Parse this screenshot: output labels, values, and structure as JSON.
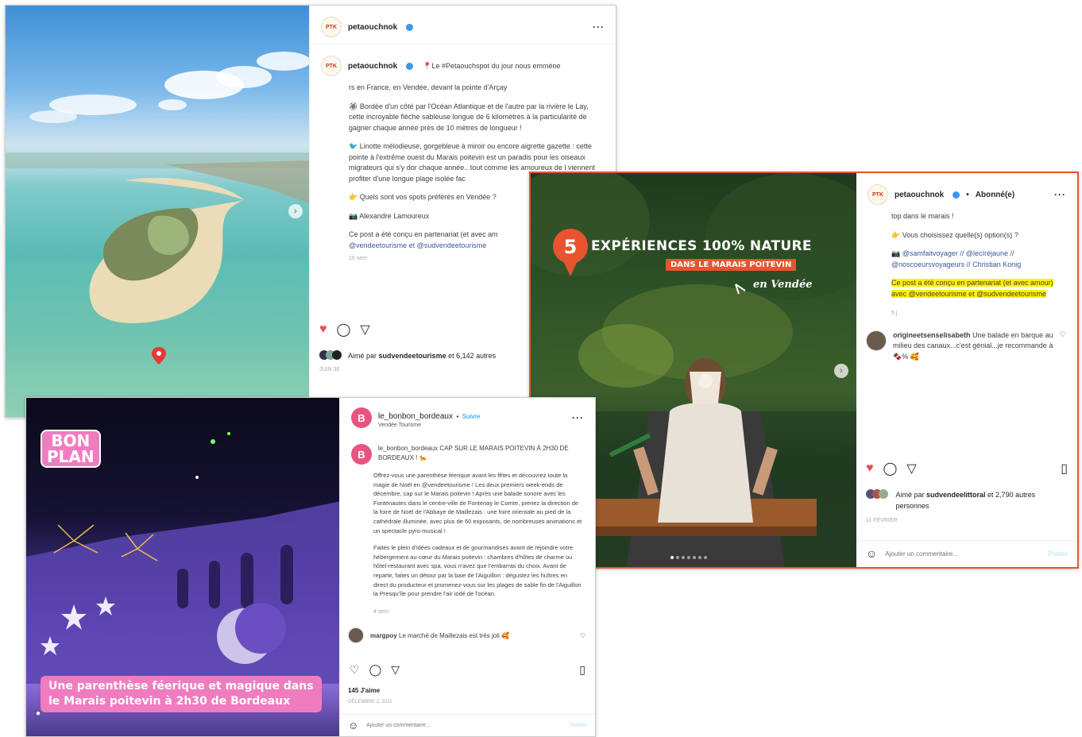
{
  "post1": {
    "username": "petaouchnok",
    "caption_intro": "📍Le #Petaouchspot du jour nous emmène",
    "caption_line2": "rs en France, en Vendée, devant la pointe d'Arçay",
    "para1": "🏵 Bordée d'un côté par l'Océan Atlantique et de l'autre par la rivière le Lay, cette incroyable flèche sableuse longue de 6 kilomètres à la particularité de gagner chaque année près de 10 mètres de longueur !",
    "para2": "🐦 Linotte mélodieuse, gorgebleue à miroir ou encore aigrette gazette : cette pointe à l'extrême ouest du Marais poitevin est un paradis pour les oiseaux migrateurs qui s'y dor chaque année.. tout comme les amoureux de l viennent profiter d'une longue plage isolée fac",
    "question": "👉 Quels sont vos spots préférés en Vendée ?",
    "photo_credit": "📷 Alexandre Lamoureux",
    "partnership": "Ce post a été conçu en partenariat (et avec am",
    "partners": "@vendeetourisme et @sudvendeetourisme",
    "time": "15 sem",
    "liked_by_prefix": "Aimé par",
    "liked_by_user": "sudvendeetourisme",
    "liked_by_rest": "et 6,142 autres",
    "date": "JUIN 30"
  },
  "post2": {
    "username": "petaouchnok",
    "follow_status": "Abonné(e)",
    "badge_number": "5",
    "headline": "EXPÉRIENCES 100% NATURE",
    "subheadline": "DANS LE MARAIS POITEVIN",
    "location_script": "en Vendée",
    "cap1": "top dans le marais !",
    "cap2": "👉 Vous choisissez quelle(s) option(s) ?",
    "cap3": "📷 @samfaitvoyager // @lecïréjaune // @noscoeursvoyageurs // Christian Konig",
    "cap4": "Ce post a été conçu en partenariat (et avec amour) avec @vendeetourisme et @sudvendeetourisme",
    "cap_time": "5 j",
    "comment_user": "origineetsenselisabeth",
    "comment_text": "Une balade en barque au milieu des canaux...c'est génial...je recommande à 🍫% 🥰",
    "liked_by_prefix": "Aimé par",
    "liked_by_user": "sudvendeelittoral",
    "liked_by_rest": "et 2,790 autres personnes",
    "date": "11 FÉVRIER",
    "comment_placeholder": "Ajouter un commentaire...",
    "publish": "Publier"
  },
  "post3": {
    "username": "le_bonbon_bordeaux",
    "follow": "Suivre",
    "subtitle": "Vendée Tourisme",
    "badge_line1": "BON",
    "badge_line2": "PLAN",
    "banner_line1": "Une parenthèse féerique et magique dans",
    "banner_line2": "le Marais poitevin à 2h30 de Bordeaux",
    "cap_title": "CAP SUR LE MARAIS POITEVIN À 2H30 DE BORDEAUX ! 🐆",
    "para1": "Offrez-vous une parenthèse féerique avant les fêtes et découvrez toute la magie de Noël en @vendeetourisme ! Les deux premiers week-ends de décembre, cap sur le Marais poitevin ! Après une balade sonore avec les Fontenautes dans le centre-ville de Fontenay le Comte, prenez la direction de la foire de Noël de l'Abbaye de Maillezais : une foire orientale au pied de la cathédrale illuminée, avec plus de 60 exposants, de nombreuses animations et un spectacle pyro-musical !",
    "para2": "Faites le plein d'idées cadeaux et de gourmandises avant de rejoindre votre hébergement au cœur du Marais poitevin : chambres d'hôtes de charme ou hôtel-restaurant avec spa, vous n'avez que l'embarras du choix. Avant de repartir, faites un détour par la baie de l'Aiguillon : dégustez les huîtres en direct du producteur et promenez-vous sur les plages de sable fin de l'Aiguillon la Presqu'île pour prendre l'air iodé de l'océan.",
    "time": "4 sem",
    "comment_user": "margpoy",
    "comment_text": "Le marché de Maillezais est très joli 🥰",
    "likes": "145 J'aime",
    "date": "DÉCEMBRE 2, 2022",
    "comment_placeholder": "Ajouter un commentaire...",
    "publish": "Publier"
  },
  "colors": {
    "accent_orange": "#e8542f",
    "pink": "#f07cc0",
    "ig_blue": "#3897f0",
    "heart_red": "#ed4956",
    "highlight": "#fff200"
  }
}
